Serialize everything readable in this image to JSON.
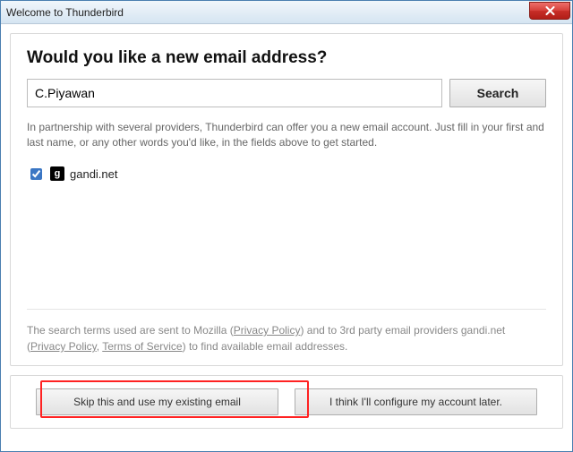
{
  "window": {
    "title": "Welcome to Thunderbird"
  },
  "main": {
    "heading": "Would you like a new email address?",
    "name_input": {
      "value": "C.Piyawan",
      "placeholder": "Your name, or nickname"
    },
    "search_label": "Search",
    "description": "In partnership with several providers, Thunderbird can offer you a new email account. Just fill in your first and last name, or any other words you'd like, in the fields above to get started."
  },
  "providers": [
    {
      "name": "gandi.net",
      "checked": true,
      "icon": "g"
    }
  ],
  "legal": {
    "text1": "The search terms used are sent to Mozilla (",
    "link1": "Privacy Policy",
    "text2": ") and to 3rd party email providers gandi.net (",
    "link2": "Privacy Policy",
    "sep": ", ",
    "link3": "Terms of Service",
    "text3": ") to find available email addresses."
  },
  "buttons": {
    "skip": "Skip this and use my existing email",
    "later": "I think I'll configure my account later."
  }
}
